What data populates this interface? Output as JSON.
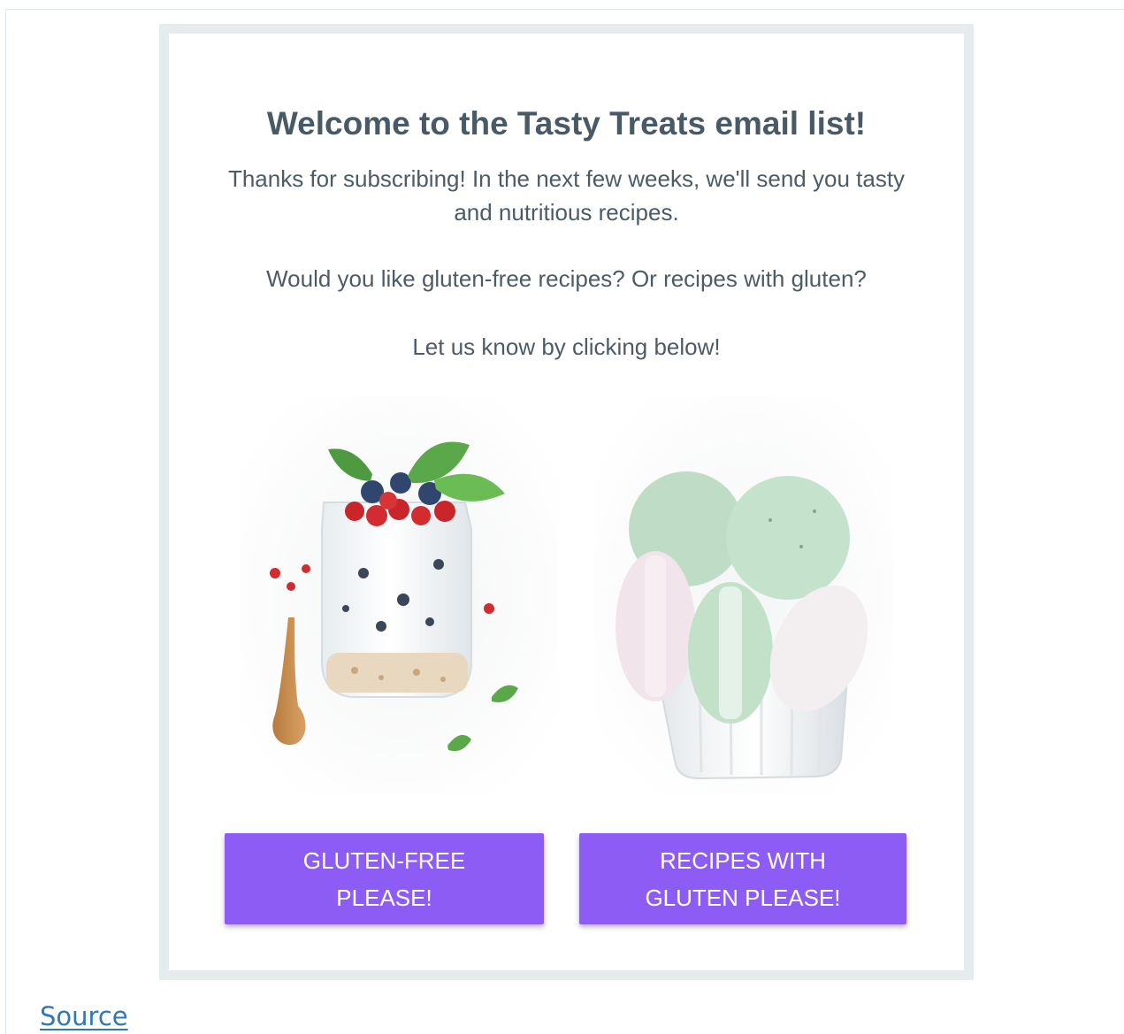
{
  "email": {
    "headline": "Welcome to the Tasty Treats email list!",
    "intro": "Thanks for subscribing! In the next few weeks, we'll send you tasty and nutritious recipes.",
    "question": "Would you like gluten-free recipes? Or recipes with gluten?",
    "cta_text": "Let us know by clicking below!",
    "buttons": [
      {
        "line1": "GLUTEN-FREE",
        "line2": "PLEASE!"
      },
      {
        "line1": "RECIPES WITH",
        "line2": "GLUTEN PLEASE!"
      }
    ]
  },
  "footer": {
    "source_label": "Source"
  },
  "colors": {
    "button": "#8c5cf5",
    "heading": "#485a66",
    "link": "#2f79b8",
    "card_border": "#e6ebee"
  }
}
